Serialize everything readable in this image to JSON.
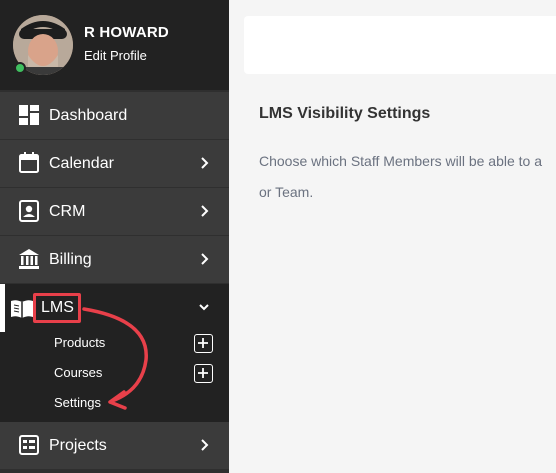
{
  "profile": {
    "name": "R HOWARD",
    "edit_label": "Edit Profile"
  },
  "nav": {
    "dashboard": "Dashboard",
    "calendar": "Calendar",
    "crm": "CRM",
    "billing": "Billing",
    "lms": "LMS",
    "projects": "Projects"
  },
  "lms_sub": {
    "products": "Products",
    "courses": "Courses",
    "settings": "Settings"
  },
  "content": {
    "title": "LMS Visibility Settings",
    "desc_line1": "Choose which Staff Members will be able to a",
    "desc_line2": "or Team."
  },
  "colors": {
    "sidebar": "#2f2f2f",
    "highlight": "#e8404a",
    "online": "#3fbf5f"
  }
}
